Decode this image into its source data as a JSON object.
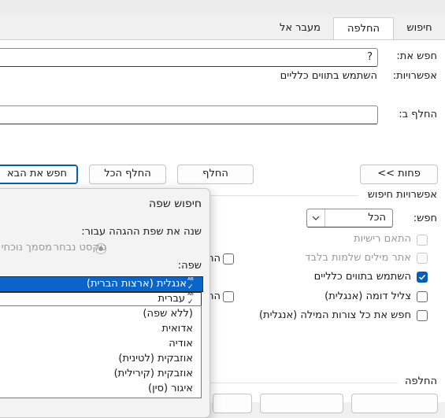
{
  "tabs": [
    {
      "label": "חיפוש"
    },
    {
      "label": "החלפה"
    },
    {
      "label": "מעבר אל"
    }
  ],
  "find": {
    "label": "חפש את:",
    "value": "?",
    "options_label": "אפשרויות:",
    "options_value": "השתמש בתווים כלליים"
  },
  "replace": {
    "label": "החלף ב:",
    "value": ""
  },
  "buttons": {
    "less": "<< פחות",
    "replace": "החלף",
    "replace_all": "החלף הכל",
    "find_next": "חפש את הבא"
  },
  "search_options": {
    "header": "אפשרויות חיפוש",
    "search_label": "חפש:",
    "search_value": "הכל",
    "checkboxes": [
      {
        "label": "התאם רישיות",
        "checked": false,
        "disabled": true
      },
      {
        "label": "אתר מילים שלמות בלבד",
        "checked": false,
        "disabled": true
      },
      {
        "label": "השתמש בתווים כלליים",
        "checked": true,
        "disabled": false
      },
      {
        "label": "צליל דומה (אנגלית)",
        "checked": false,
        "disabled": false
      },
      {
        "label": "חפש את כל צורות המילה (אנגלית)",
        "checked": false,
        "disabled": false
      }
    ],
    "partial_checkbox_labels": [
      "הת",
      "הת"
    ]
  },
  "replace_section": {
    "header": "החלפה"
  },
  "language_dialog": {
    "title": "חיפוש שפה",
    "direction_label": "שנה את שפת ההגהה עבור:",
    "radio_selected_text": "טקסט נבחר",
    "radio_current_doc": "מסמך נוכחי",
    "language_label": "שפה:",
    "selected_language": "אנגלית (ארצות הברית)",
    "second_language": "עברית",
    "list_items": [
      "(ללא שפה)",
      "אדואית",
      "אודיה",
      "אוזבקית (לטינית)",
      "אוזבקית (קירילית)",
      "איגור (סין)"
    ]
  },
  "colors": {
    "accent": "#005fb8",
    "selection": "#0a64c9"
  }
}
